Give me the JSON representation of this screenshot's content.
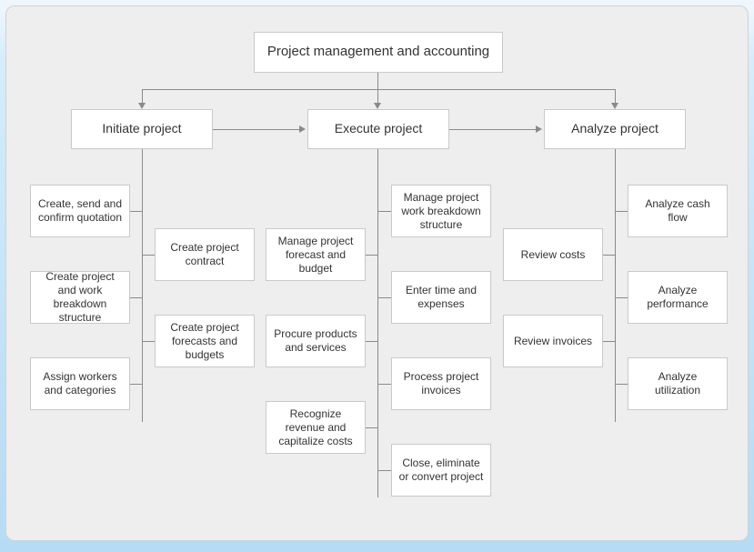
{
  "diagram": {
    "root": "Project management and accounting",
    "phases": {
      "initiate": "Initiate project",
      "execute": "Execute project",
      "analyze": "Analyze project"
    },
    "initiate": {
      "left": [
        "Create, send and confirm quotation",
        "Create project and work breakdown structure",
        "Assign workers and categories"
      ],
      "right": [
        "Create project contract",
        "Create project forecasts and budgets"
      ]
    },
    "execute": {
      "left": [
        "Manage project forecast and budget",
        "Procure products and services",
        "Recognize revenue and capitalize costs"
      ],
      "right": [
        "Manage project work breakdown structure",
        "Enter time and expenses",
        "Process project invoices",
        "Close, eliminate or convert project"
      ]
    },
    "analyze": {
      "left": [
        "Review costs",
        "Review invoices"
      ],
      "right": [
        "Analyze cash flow",
        "Analyze performance",
        "Analyze utilization"
      ]
    }
  }
}
